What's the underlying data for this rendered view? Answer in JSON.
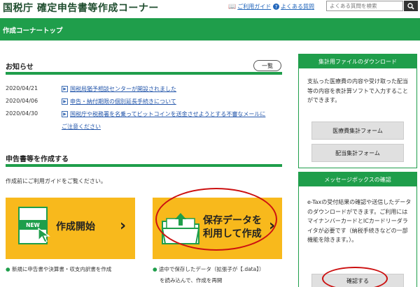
{
  "header": {
    "site_title": "国税庁 確定申告書等作成コーナー",
    "guide_link": "ご利用ガイド",
    "faq_link": "よくある質問",
    "search_placeholder": "よくある質問を検索"
  },
  "topbar": {
    "title": "作成コーナートップ"
  },
  "notices": {
    "title": "お知らせ",
    "list_button": "一覧",
    "items": [
      {
        "date": "2020/04/21",
        "text": "国税局猶予相談センターが開設されました"
      },
      {
        "date": "2020/04/06",
        "text": "申告・納付期限の個別延長手続きについて"
      },
      {
        "date": "2020/04/30",
        "text": "国税庁や税務署を名乗ってビットコインを送金させようとする不審なメールに",
        "cont": "ご注意ください"
      }
    ]
  },
  "create": {
    "title": "申告書等を作成する",
    "intro": "作成前にご利用ガイドをご覧ください。",
    "new_card": {
      "badge": "NEW",
      "label": "作成開始",
      "note": "新規に申告書や決算書・収支内訳書を作成"
    },
    "saved_card": {
      "label_line1": "保存データを",
      "label_line2": "利用して作成",
      "note_line1": "途中で保存したデータ（拡張子が【.data】）",
      "note_line2": "を読み込んで、作成を再開"
    }
  },
  "download_panel": {
    "title": "集計用ファイルのダウンロード",
    "text": "支払った医療費の内容や受け取った配当等の内容を表計算ソフトで入力することができます。",
    "btn1": "医療費集計フォーム",
    "btn2": "配当集計フォーム"
  },
  "message_panel": {
    "title": "メッセージボックスの確認",
    "text": "e-Taxの受付結果の確認や送信したデータのダウンロードができます。ご利用にはマイナンバーカードとICカードリーダライタが必要です（納税手続きなどの一部機能を除きます。）。",
    "btn": "確認する"
  },
  "colors": {
    "green": "#1f9e4b",
    "yellow": "#f8b91c",
    "red": "#cc1111"
  }
}
